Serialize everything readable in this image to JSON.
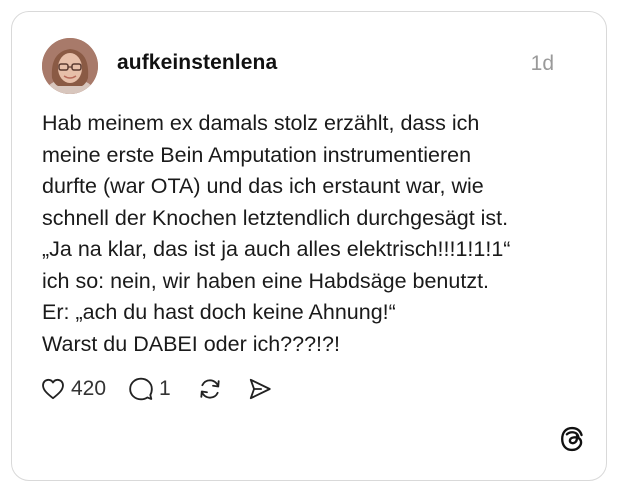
{
  "post": {
    "username": "aufkeinstenlena",
    "timestamp": "1d",
    "lines": [
      "Hab meinem ex damals stolz erzählt, dass ich",
      "meine erste Bein Amputation instrumentieren",
      "durfte (war OTA) und das ich erstaunt war, wie",
      "schnell der Knochen letztendlich durchgesägt ist.",
      "„Ja na klar, das ist ja auch alles elektrisch!!!1!1!1“",
      "ich so: nein, wir haben eine Habdsäge benutzt.",
      "Er: „ach du hast doch keine Ahnung!“",
      "Warst du DABEI oder ich???!?!"
    ]
  },
  "actions": {
    "like_count": "420",
    "reply_count": "1",
    "like_icon": "heart-icon",
    "reply_icon": "comment-icon",
    "repost_icon": "repost-icon",
    "share_icon": "send-icon"
  },
  "brand": {
    "icon": "threads-logo-icon"
  },
  "colors": {
    "border": "#d9d9d9",
    "text": "#1a1a1a",
    "muted": "#9a9a9a"
  }
}
